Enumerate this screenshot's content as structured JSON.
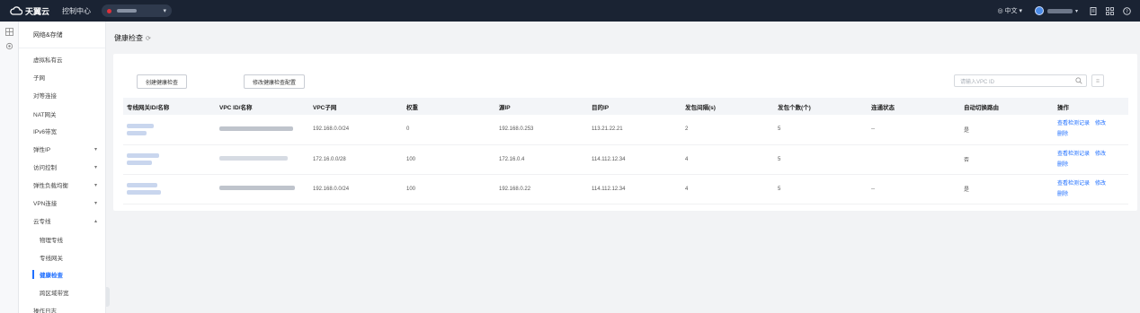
{
  "topbar": {
    "logo_text": "天翼云",
    "console_label": "控制中心",
    "lang_label": "中文",
    "icons": [
      "user-avatar",
      "document-icon",
      "apps-icon",
      "help-icon"
    ]
  },
  "sidebar": {
    "header": "网络&存储",
    "items": [
      {
        "label": "虚拟私有云"
      },
      {
        "label": "子网"
      },
      {
        "label": "对等连接"
      },
      {
        "label": "NAT网关"
      },
      {
        "label": "IPv6带宽"
      },
      {
        "label": "弹性IP"
      },
      {
        "label": "访问控制"
      },
      {
        "label": "弹性负载均衡"
      },
      {
        "label": "VPN连接"
      },
      {
        "label": "云专线"
      },
      {
        "label": "物理专线"
      },
      {
        "label": "专线网关"
      },
      {
        "label": "健康检查"
      },
      {
        "label": "跨区域带宽"
      },
      {
        "label": "操作日志"
      }
    ]
  },
  "page": {
    "title": "健康检查",
    "btn_create": "创建健康检查",
    "btn_modify": "修改健康检查配置",
    "search_placeholder": "请输入VPC ID"
  },
  "table": {
    "headers": [
      "专线网关ID/名称",
      "VPC ID/名称",
      "VPC子网",
      "权重",
      "源IP",
      "目的IP",
      "发包间隔(s)",
      "发包个数(个)",
      "连通状态",
      "自动切换路由",
      "操作"
    ],
    "rows": [
      {
        "vpc_subnet": "192.168.0.0/24",
        "weight": "0",
        "src_ip": "192.168.0.253",
        "dst_ip": "113.21.22.21",
        "interval": "2",
        "count": "5",
        "status": "--",
        "auto_switch": "是",
        "ops": [
          "查看检测记录",
          "修改",
          "删除"
        ]
      },
      {
        "vpc_subnet": "172.16.0.0/28",
        "weight": "100",
        "src_ip": "172.16.0.4",
        "dst_ip": "114.112.12.34",
        "interval": "4",
        "count": "5",
        "status": "",
        "auto_switch": "否",
        "ops": [
          "查看检测记录",
          "修改",
          "删除"
        ]
      },
      {
        "vpc_subnet": "192.168.0.0/24",
        "weight": "100",
        "src_ip": "192.168.0.22",
        "dst_ip": "114.112.12.34",
        "interval": "4",
        "count": "5",
        "status": "--",
        "auto_switch": "是",
        "ops": [
          "查看检测记录",
          "修改",
          "删除"
        ]
      }
    ]
  },
  "colors": {
    "topbar": "#1a2333",
    "accent": "#2170ff",
    "region_dot": "#e0303a"
  }
}
